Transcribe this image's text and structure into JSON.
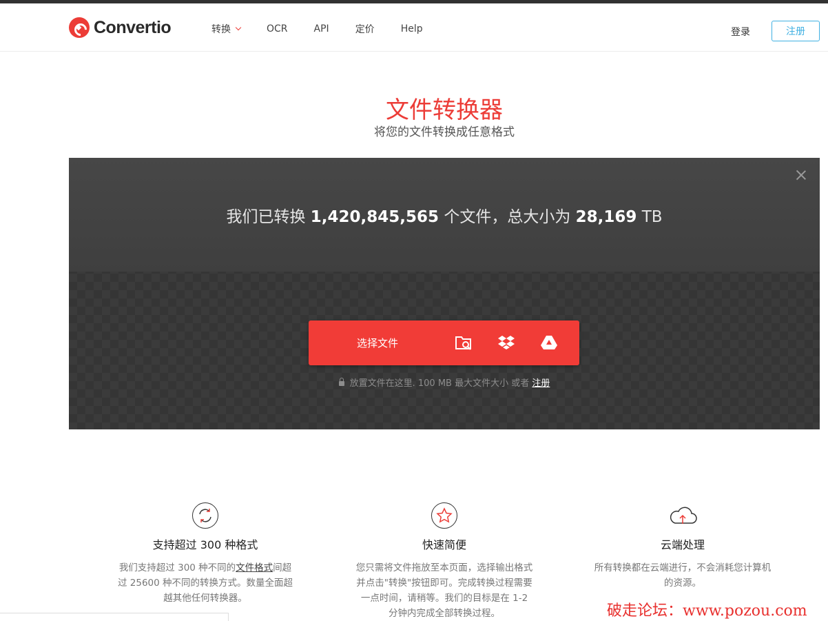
{
  "header": {
    "brand": "Convertio",
    "nav": [
      {
        "label": "转换",
        "has_dropdown": true
      },
      {
        "label": "OCR"
      },
      {
        "label": "API"
      },
      {
        "label": "定价"
      },
      {
        "label": "Help"
      }
    ],
    "login_label": "登录",
    "signup_label": "注册"
  },
  "hero": {
    "title": "文件转换器",
    "subtitle": "将您的文件转换成任意格式"
  },
  "dropzone": {
    "stats_prefix": "我们已转换",
    "files_count": "1,420,845,565",
    "stats_mid": "个文件，总大小为",
    "total_size": "28,169",
    "size_unit": "TB",
    "choose_label": "选择文件",
    "note_text": "放置文件在这里. 100 MB 最大文件大小 或者",
    "note_link": "注册"
  },
  "features": [
    {
      "title": "支持超过 300 种格式",
      "text_before": "我们支持超过 300 种不同的",
      "link": "文件格式",
      "text_after": "间超过 25600 种不同的转换方式。数量全面超越其他任何转换器。",
      "icon": "refresh-icon"
    },
    {
      "title": "快速简便",
      "text": "您只需将文件拖放至本页面，选择输出格式并点击\"转换\"按钮即可。完成转换过程需要一点时间，请稍等。我们的目标是在 1-2 分钟内完成全部转换过程。",
      "icon": "star-icon"
    },
    {
      "title": "云端处理",
      "text": "所有转换都在云端进行，不会消耗您计算机的资源。",
      "icon": "cloud-upload-icon"
    }
  ],
  "watermark": "破走论坛：www.pozou.com",
  "colors": {
    "accent": "#f13c37",
    "signup": "#3fb0e2",
    "dropzone": "#3b3b3b"
  }
}
